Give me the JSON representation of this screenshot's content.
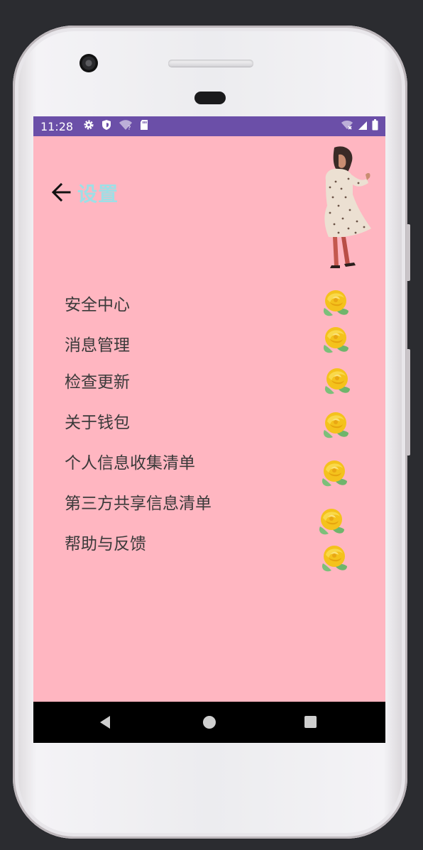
{
  "statusbar": {
    "time": "11:28",
    "icons_left": [
      "gear-icon",
      "shield-icon",
      "wifi-question-icon",
      "sd-card-icon"
    ],
    "icons_right": [
      "wifi-off-icon",
      "cellular-signal-icon",
      "battery-icon"
    ]
  },
  "appbar": {
    "back_icon": "arrow-left-icon",
    "title": "设置"
  },
  "menu": {
    "items": [
      {
        "label": "安全中心"
      },
      {
        "label": "消息管理"
      },
      {
        "label": "检查更新"
      },
      {
        "label": "关于钱包"
      },
      {
        "label": "个人信息收集清单"
      },
      {
        "label": "第三方共享信息清单"
      },
      {
        "label": "帮助与反馈"
      }
    ]
  },
  "decor": {
    "illustration": "standing-girl-illustration",
    "item_icon": "yellow-rose-icon"
  },
  "navbar": {
    "icons": [
      "nav-back-icon",
      "nav-home-icon",
      "nav-recent-icon"
    ]
  },
  "colors": {
    "background": "#ffb6c1",
    "statusbar": "#6b4fa8",
    "title": "#9edfe6",
    "text": "#3a3a3a"
  }
}
